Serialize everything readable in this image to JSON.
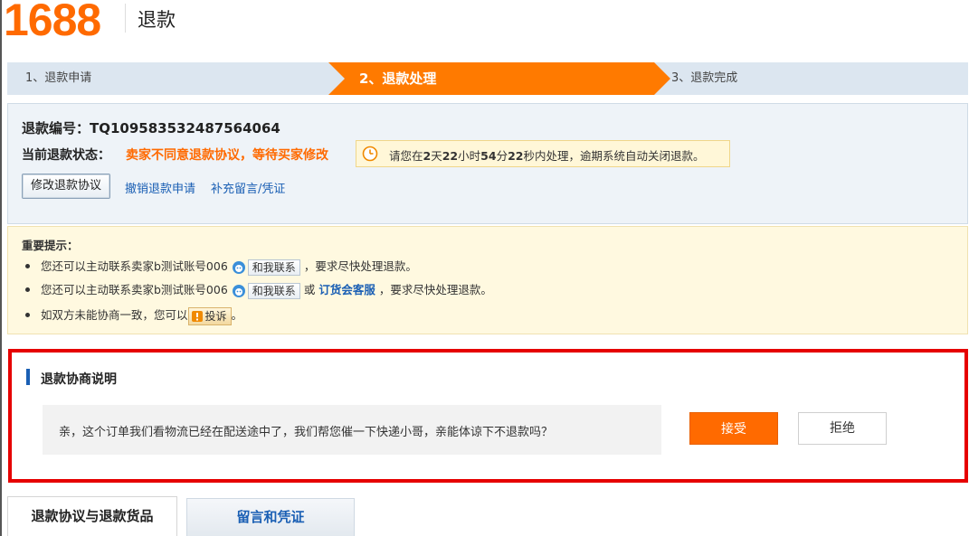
{
  "header": {
    "logo": "1688",
    "title": "退款"
  },
  "steps": [
    {
      "label": "1、退款申请"
    },
    {
      "label": "2、退款处理"
    },
    {
      "label": "3、退款完成"
    }
  ],
  "refund": {
    "id_label": "退款编号：",
    "id_value": "TQ109583532487564064",
    "status_label": "当前退款状态：",
    "status_value": "卖家不同意退款协议，等待买家修改",
    "timer": {
      "prefix": "请您在",
      "days": "2",
      "days_unit": "天",
      "hours": "22",
      "hours_unit": "小时",
      "minutes": "54",
      "minutes_unit": "分",
      "seconds": "22",
      "seconds_unit": "秒内处理，逾期系统自动关闭退款。"
    },
    "actions": {
      "modify": "修改退款协议",
      "cancel": "撤销退款申请",
      "supplement": "补充留言/凭证"
    }
  },
  "tips": {
    "title": "重要提示：",
    "item1_prefix": "您还可以主动联系卖家b测试账号006",
    "item1_suffix": "，要求尽快处理退款。",
    "item2_prefix": "您还可以主动联系卖家b测试账号006",
    "item2_or": "或",
    "item2_service": "订货会客服",
    "item2_suffix": "，要求尽快处理退款。",
    "item3_prefix": "如双方未能协商一致，您可以",
    "item3_suffix": "。",
    "contact_label": "和我联系",
    "complain_label": "投诉"
  },
  "negotiation": {
    "title": "退款协商说明",
    "message": "亲，这个订单我们看物流已经在配送途中了，我们帮您催一下快递小哥，亲能体谅下不退款吗？",
    "accept": "接受",
    "reject": "拒绝"
  },
  "tabs": [
    {
      "label": "退款协议与退款货品"
    },
    {
      "label": "留言和凭证"
    }
  ],
  "colors": {
    "brand": "#ff6a00",
    "link": "#1a5fb4",
    "highlight_border": "#e60000"
  }
}
